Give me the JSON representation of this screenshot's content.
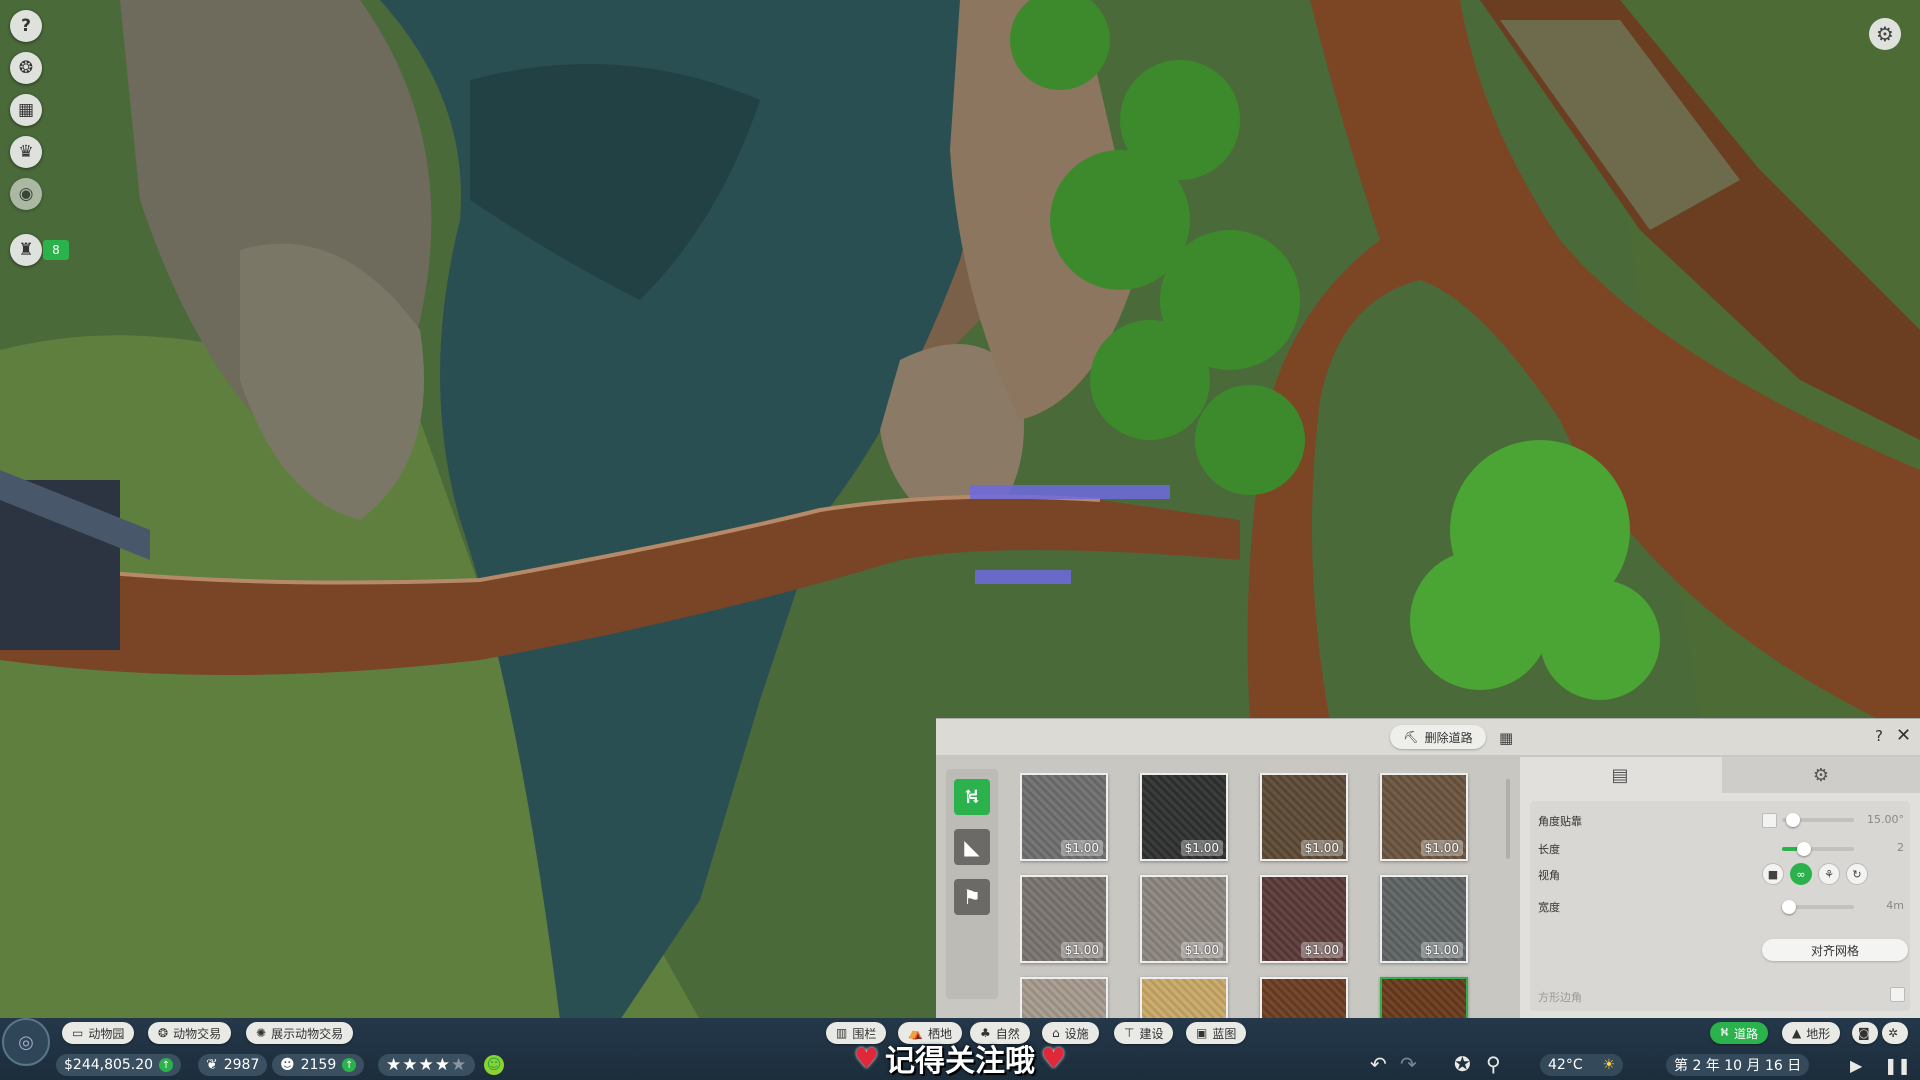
{
  "left_toolbar": {
    "icons": [
      "help-icon",
      "paw-icon",
      "calendar-icon",
      "trophy-icon",
      "eye-icon",
      "staff-icon"
    ],
    "staff_badge": "8"
  },
  "path_panel": {
    "delete_path_label": "删除道路",
    "side_tabs": [
      "path-icon",
      "ramp-icon",
      "queue-icon"
    ],
    "tiles": [
      {
        "price": "$1.00",
        "color": "#6f6f6f"
      },
      {
        "price": "$1.00",
        "color": "#2f3030"
      },
      {
        "price": "$1.00",
        "color": "#5c4a35"
      },
      {
        "price": "$1.00",
        "color": "#6a5440"
      },
      {
        "price": "$1.00",
        "color": "#7a7470"
      },
      {
        "price": "$1.00",
        "color": "#8c8580"
      },
      {
        "price": "$1.00",
        "color": "#5a3a38"
      },
      {
        "price": "$1.00",
        "color": "#5e6364"
      },
      {
        "price": "",
        "color": "#a59a8c"
      },
      {
        "price": "",
        "color": "#c9a868"
      },
      {
        "price": "",
        "color": "#6b3e22"
      },
      {
        "price": "",
        "color": "#6a3a1c"
      }
    ],
    "settings": {
      "angle_snap_label": "角度贴靠",
      "angle_snap_value": "15.00°",
      "angle_snap_fraction": 0.15,
      "length_label": "长度",
      "length_value": "2",
      "length_fraction": 0.3,
      "view_label": "视角",
      "width_label": "宽度",
      "width_value": "4m",
      "width_fraction": 0.1,
      "align_grid_label": "对齐网格",
      "square_corner_label": "方形边角"
    }
  },
  "bottom_bar": {
    "tabs_left": [
      "动物园",
      "动物交易",
      "展示动物交易"
    ],
    "money": "$244,805.20",
    "conservation": "2987",
    "guests": "2159",
    "rating_stars": 4,
    "rating_max": 5,
    "build_tabs": [
      "围栏",
      "栖地",
      "自然",
      "设施",
      "建设",
      "蓝图"
    ],
    "caption": "记得关注哦",
    "right_tabs": [
      "道路",
      "地形"
    ],
    "temperature": "42°C",
    "date": "第 2 年 10 月 16 日"
  },
  "colors": {
    "accent_green": "#2bb24c",
    "bar_bg": "#1f3242",
    "boardwalk": "#7a4526"
  }
}
